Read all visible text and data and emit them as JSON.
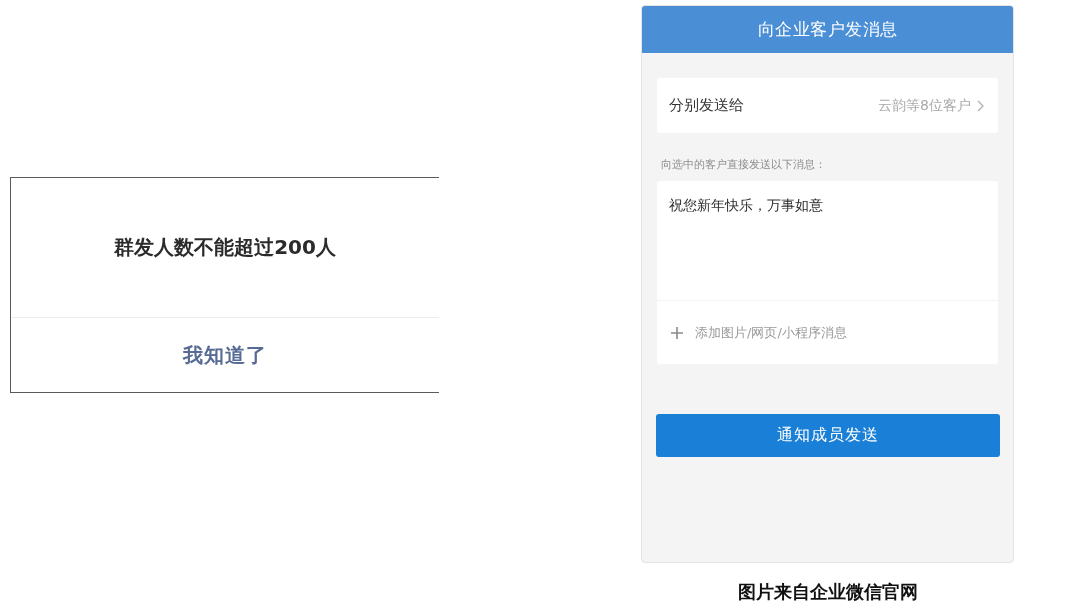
{
  "alert_dialog": {
    "message": "群发人数不能超过200人",
    "button": "我知道了"
  },
  "phone_screen": {
    "title": "向企业客户发消息",
    "recipients": {
      "label": "分别发送给",
      "value": "云韵等8位客户"
    },
    "hint": "向选中的客户直接发送以下消息：",
    "message": {
      "value": "祝您新年快乐，万事如意",
      "attachment": "添加图片/网页/小程序消息"
    },
    "send_button": "通知成员发送"
  },
  "caption": "图片来自企业微信官网"
}
